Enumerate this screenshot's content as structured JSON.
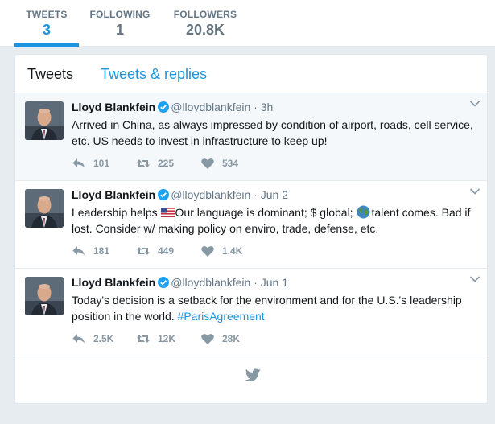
{
  "stats": [
    {
      "label": "TWEETS",
      "value": "3"
    },
    {
      "label": "FOLLOWING",
      "value": "1"
    },
    {
      "label": "FOLLOWERS",
      "value": "20.8K"
    }
  ],
  "tabs": {
    "tweets": "Tweets",
    "replies": "Tweets & replies"
  },
  "tweets": [
    {
      "name": "Lloyd Blankfein",
      "handle": "@lloydblankfein",
      "sep": "·",
      "time": "3h",
      "text": "Arrived in China, as always impressed by condition of airport, roads, cell service, etc. US needs to invest in infrastructure to keep up!",
      "replies": "101",
      "retweets": "225",
      "likes": "534"
    },
    {
      "name": "Lloyd Blankfein",
      "handle": "@lloydblankfein",
      "sep": "·",
      "time": "Jun 2",
      "text_a": "Leadership helps ",
      "text_b": "Our language is dominant; $ global; ",
      "text_c": "talent comes. Bad if lost. Consider w/ making policy on enviro, trade, defense, etc.",
      "replies": "181",
      "retweets": "449",
      "likes": "1.4K"
    },
    {
      "name": "Lloyd Blankfein",
      "handle": "@lloydblankfein",
      "sep": "·",
      "time": "Jun 1",
      "text": "Today's decision is a setback for the environment and for the U.S.'s leadership position in the world. ",
      "hashtag": "#ParisAgreement",
      "replies": "2.5K",
      "retweets": "12K",
      "likes": "28K"
    }
  ],
  "colors": {
    "accent": "#1b95e0",
    "muted": "#657786",
    "icon": "#8899a6"
  }
}
